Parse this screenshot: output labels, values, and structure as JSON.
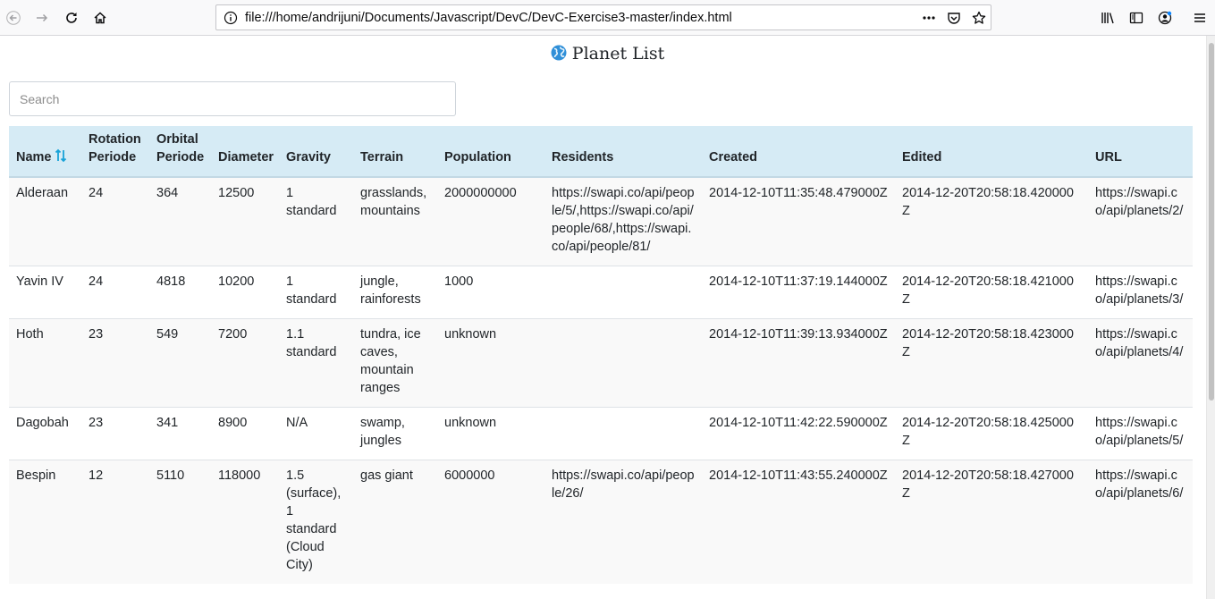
{
  "browser": {
    "url": "file:///home/andrijuni/Documents/Javascript/DevC/DevC-Exercise3-master/index.html",
    "icons": [
      "back-icon",
      "forward-icon",
      "reload-icon",
      "home-icon",
      "info-icon",
      "more-icon",
      "pocket-icon",
      "bookmark-star-icon",
      "library-icon",
      "sidebar-icon",
      "account-icon",
      "menu-icon"
    ]
  },
  "page": {
    "title": "Planet List",
    "search_placeholder": "Search"
  },
  "table": {
    "columns": [
      {
        "label": "Name",
        "key": "name",
        "sortable": true
      },
      {
        "label": "Rotation Periode",
        "key": "rotation"
      },
      {
        "label": "Orbital Periode",
        "key": "orbital"
      },
      {
        "label": "Diameter",
        "key": "diameter"
      },
      {
        "label": "Gravity",
        "key": "gravity"
      },
      {
        "label": "Terrain",
        "key": "terrain"
      },
      {
        "label": "Population",
        "key": "population"
      },
      {
        "label": "Residents",
        "key": "residents"
      },
      {
        "label": "Created",
        "key": "created"
      },
      {
        "label": "Edited",
        "key": "edited"
      },
      {
        "label": "URL",
        "key": "url"
      }
    ],
    "rows": [
      {
        "name": "Alderaan",
        "rotation": "24",
        "orbital": "364",
        "diameter": "12500",
        "gravity": "1 standard",
        "terrain": "grasslands, mountains",
        "population": "2000000000",
        "residents": "https://swapi.co/api/people/5/,https://swapi.co/api/people/68/,https://swapi.co/api/people/81/",
        "created": "2014-12-10T11:35:48.479000Z",
        "edited": "2014-12-20T20:58:18.420000Z",
        "url": "https://swapi.co/api/planets/2/"
      },
      {
        "name": "Yavin IV",
        "rotation": "24",
        "orbital": "4818",
        "diameter": "10200",
        "gravity": "1 standard",
        "terrain": "jungle, rainforests",
        "population": "1000",
        "residents": "",
        "created": "2014-12-10T11:37:19.144000Z",
        "edited": "2014-12-20T20:58:18.421000Z",
        "url": "https://swapi.co/api/planets/3/"
      },
      {
        "name": "Hoth",
        "rotation": "23",
        "orbital": "549",
        "diameter": "7200",
        "gravity": "1.1 standard",
        "terrain": "tundra, ice caves, mountain ranges",
        "population": "unknown",
        "residents": "",
        "created": "2014-12-10T11:39:13.934000Z",
        "edited": "2014-12-20T20:58:18.423000Z",
        "url": "https://swapi.co/api/planets/4/"
      },
      {
        "name": "Dagobah",
        "rotation": "23",
        "orbital": "341",
        "diameter": "8900",
        "gravity": "N/A",
        "terrain": "swamp, jungles",
        "population": "unknown",
        "residents": "",
        "created": "2014-12-10T11:42:22.590000Z",
        "edited": "2014-12-20T20:58:18.425000Z",
        "url": "https://swapi.co/api/planets/5/"
      },
      {
        "name": "Bespin",
        "rotation": "12",
        "orbital": "5110",
        "diameter": "118000",
        "gravity": "1.5 (surface), 1 standard (Cloud City)",
        "terrain": "gas giant",
        "population": "6000000",
        "residents": "https://swapi.co/api/people/26/",
        "created": "2014-12-10T11:43:55.240000Z",
        "edited": "2014-12-20T20:58:18.427000Z",
        "url": "https://swapi.co/api/planets/6/"
      }
    ]
  },
  "colors": {
    "header_bg": "#d6ebf5",
    "sort_icon": "#17a2d8",
    "globe": "#2f8fd8"
  }
}
